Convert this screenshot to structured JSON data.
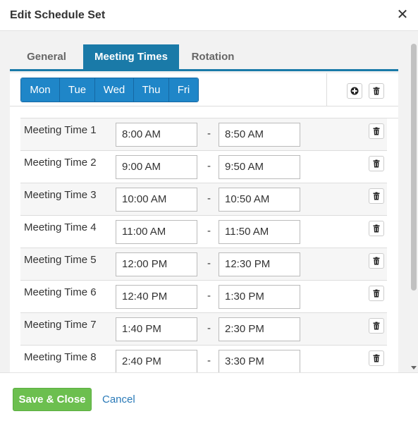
{
  "dialog": {
    "title": "Edit Schedule Set",
    "close_icon": "close-icon",
    "close_glyph": "✕"
  },
  "tabs": [
    {
      "label": "General",
      "active": false
    },
    {
      "label": "Meeting Times",
      "active": true
    },
    {
      "label": "Rotation",
      "active": false
    }
  ],
  "days": [
    "Mon",
    "Tue",
    "Wed",
    "Thu",
    "Fri"
  ],
  "toolbar": {
    "add_icon": "plus-circle-icon",
    "delete_icon": "trash-icon"
  },
  "meeting_times": [
    {
      "label": "Meeting Time 1",
      "start": "8:00 AM",
      "end": "8:50 AM"
    },
    {
      "label": "Meeting Time 2",
      "start": "9:00 AM",
      "end": "9:50 AM"
    },
    {
      "label": "Meeting Time 3",
      "start": "10:00 AM",
      "end": "10:50 AM"
    },
    {
      "label": "Meeting Time 4",
      "start": "11:00 AM",
      "end": "11:50 AM"
    },
    {
      "label": "Meeting Time 5",
      "start": "12:00 PM",
      "end": "12:30 PM"
    },
    {
      "label": "Meeting Time 6",
      "start": "12:40 PM",
      "end": "1:30 PM"
    },
    {
      "label": "Meeting Time 7",
      "start": "1:40 PM",
      "end": "2:30 PM"
    },
    {
      "label": "Meeting Time 8",
      "start": "2:40 PM",
      "end": "3:30 PM"
    }
  ],
  "separator": "-",
  "footer": {
    "save_label": "Save & Close",
    "cancel_label": "Cancel"
  },
  "colors": {
    "accent": "#1a7aa8",
    "day_button": "#1f86c8",
    "save_button": "#6cbf4f",
    "link": "#2a7ab8"
  }
}
